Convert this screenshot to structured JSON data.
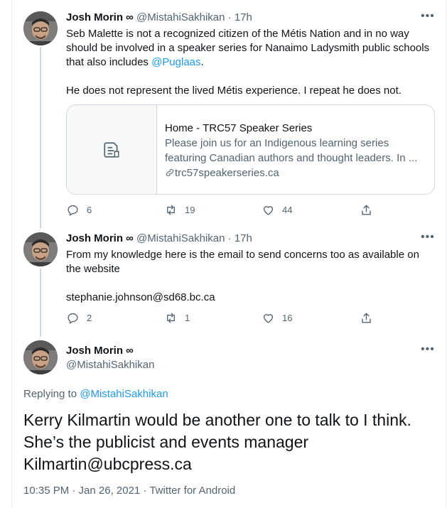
{
  "tweets": [
    {
      "name": "Josh Morin ∞",
      "handle": "@MistahiSakhikan",
      "time": "· 17h",
      "more": "•••",
      "text_line1": "Seb Malette is not a recognized citizen of the Métis Nation and in no way",
      "text_line2": "should be involved in a speaker series for Nanaimo Ladysmith public schools",
      "text_line3_prefix": "that also includes ",
      "text_line3_mention": "@Puglaas",
      "text_line3_suffix": ".",
      "text_line4": "He does not represent the lived Métis experience. I repeat he does not.",
      "card": {
        "title": "Home - TRC57 Speaker Series",
        "desc_line1": "Please join us for an Indigenous learning series",
        "desc_line2": "featuring Canadian authors and thought leaders. In ...",
        "link": "trc57speakerseries.ca"
      },
      "replies": "6",
      "retweets": "19",
      "likes": "44"
    },
    {
      "name": "Josh Morin ∞",
      "handle": "@MistahiSakhikan",
      "time": "· 17h",
      "more": "•••",
      "text_line1": "From my knowledge here is the email to send concerns too as available on",
      "text_line2": "the website",
      "text_line3": "stephanie.johnson@sd68.bc.ca",
      "replies": "2",
      "retweets": "1",
      "likes": "16"
    }
  ],
  "main": {
    "name": "Josh Morin ∞",
    "handle": "@MistahiSakhikan",
    "more": "•••",
    "replying_prefix": "Replying to ",
    "replying_handle": "@MistahiSakhikan",
    "text_line1": "Kerry Kilmartin would be another one to talk to I think.",
    "text_line2": "She’s the publicist and events manager",
    "text_line3": "Kilmartin@ubcpress.ca",
    "meta": "10:35 PM · Jan 26, 2021 · Twitter for Android"
  },
  "colors": {
    "accent": "#1d9bf0",
    "secondary_text": "#536471",
    "primary_text": "#0f1419"
  },
  "icons": [
    "reply-icon",
    "retweet-icon",
    "like-icon",
    "share-icon",
    "article-icon",
    "link-icon"
  ]
}
